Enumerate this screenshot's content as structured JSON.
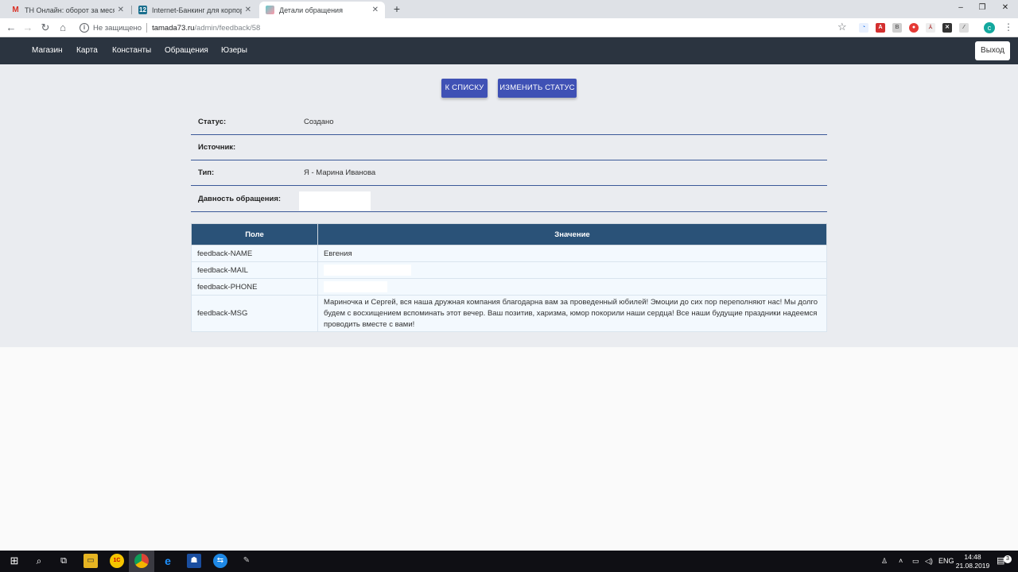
{
  "browser": {
    "tabs": [
      {
        "title": "ТН Онлайн: оборот за месяц - ",
        "icon": "gmail-icon"
      },
      {
        "title": "Internet-Банкинг для корпорати",
        "icon": "bank-icon"
      },
      {
        "title": "Детали обращения",
        "icon": "site-icon",
        "active": true
      }
    ],
    "new_tab": "+",
    "window_controls": [
      "–",
      "❐",
      "✕"
    ],
    "address": {
      "security_label": "Не защищено",
      "host": "tamada73.ru",
      "path": "/admin/feedback/58"
    }
  },
  "nav": {
    "links": [
      "Магазин",
      "Карта",
      "Константы",
      "Обращения",
      "Юзеры"
    ],
    "logout": "Выход"
  },
  "actions": {
    "back_to_list": "К СПИСКУ",
    "change_status": "ИЗМЕНИТЬ СТАТУС"
  },
  "details": {
    "status_label": "Статус:",
    "status_value": "Создано",
    "source_label": "Источник:",
    "source_value": "",
    "type_label": "Тип:",
    "type_value": "Я - Марина Иванова",
    "age_label": "Давность обращения:"
  },
  "table": {
    "headers": [
      "Поле",
      "Значение"
    ],
    "rows": [
      {
        "field": "feedback-NAME",
        "value": "Евгения"
      },
      {
        "field": "feedback-MAIL",
        "value": ""
      },
      {
        "field": "feedback-PHONE",
        "value": ""
      },
      {
        "field": "feedback-MSG",
        "value": "Мариночка и Сергей, вся наша дружная компания благодарна вам за проведенный юбилей! Эмоции до сих пор переполняют нас! Мы долго будем с восхищением вспоминать этот вечер. Ваш позитив, харизма, юмор покорили наши сердца! Все наши будущие праздники надеемся проводить вместе с вами!"
      }
    ]
  },
  "taskbar": {
    "language": "ENG",
    "time": "14:48",
    "date": "21.08.2019",
    "notifications": "3"
  },
  "colors": {
    "navbar": "#2b3440",
    "button": "#3f51b5",
    "table_header": "#2a5278",
    "row_divider": "#3b5998"
  }
}
